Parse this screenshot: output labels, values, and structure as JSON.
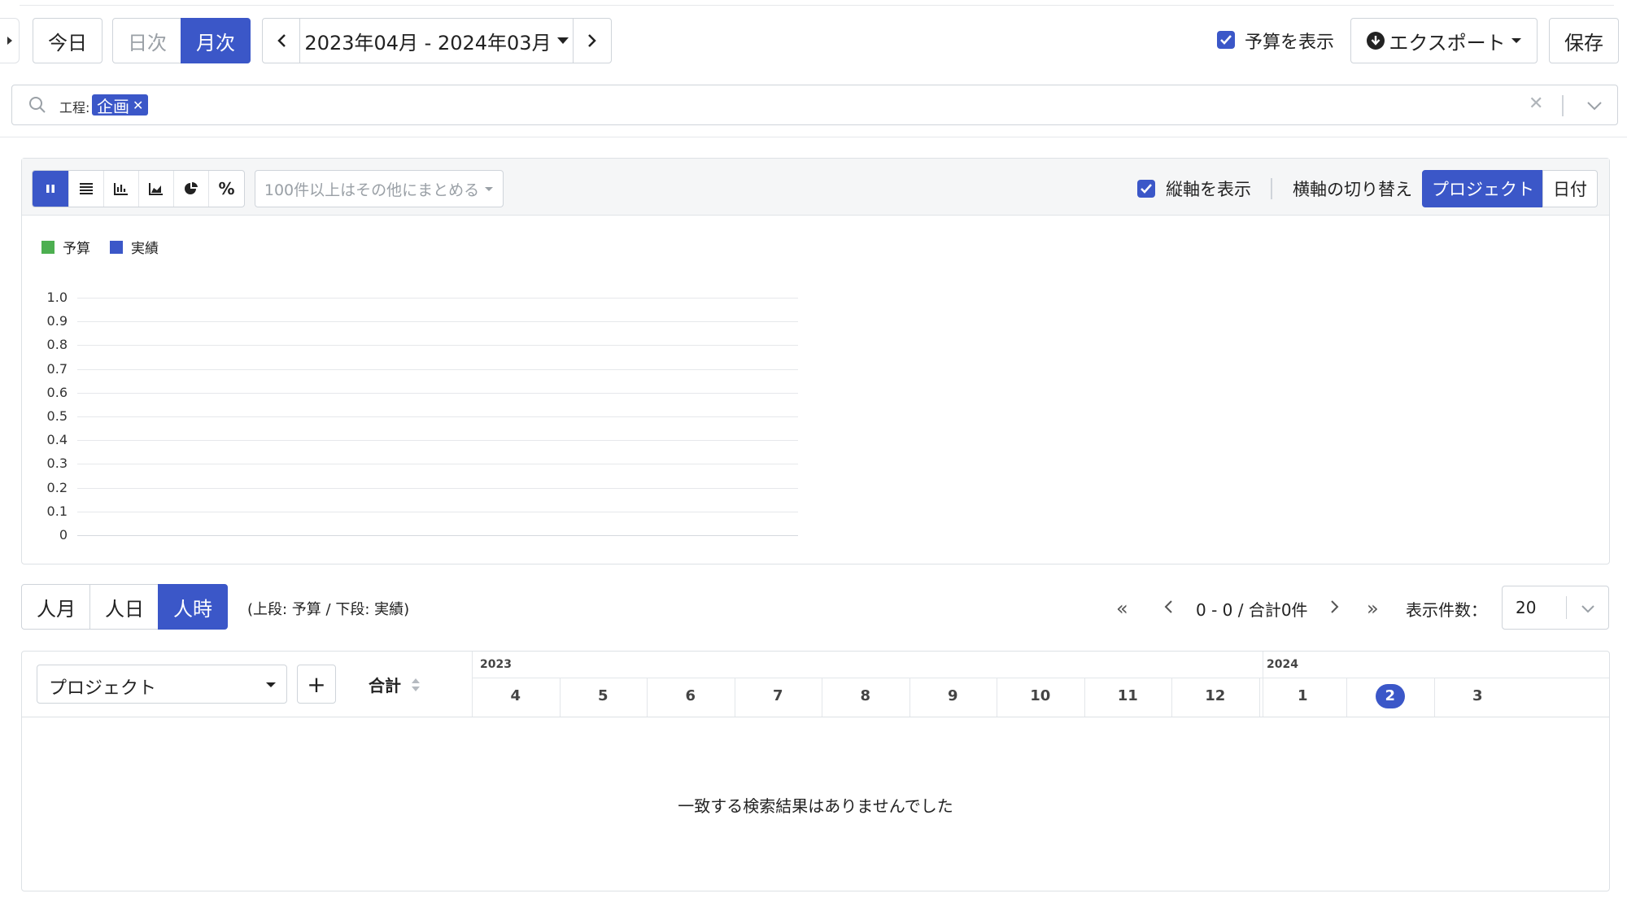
{
  "toolbar": {
    "today": "今日",
    "daily": "日次",
    "monthly": "月次",
    "date_range": "2023年04月 - 2024年03月",
    "show_budget": "予算を表示",
    "export": "エクスポート",
    "save": "保存"
  },
  "filter": {
    "label": "工程:",
    "tag": "企画"
  },
  "chart_toolbar": {
    "group_others": "100件以上はその他にまとめる",
    "show_vertical_axis": "縦軸を表示",
    "switch_horizontal_axis": "横軸の切り替え",
    "axis_project": "プロジェクト",
    "axis_date": "日付"
  },
  "chart_data": {
    "type": "bar",
    "categories": [],
    "series": [
      {
        "name": "予算",
        "color": "#4caf50",
        "values": []
      },
      {
        "name": "実績",
        "color": "#3b57c8",
        "values": []
      }
    ],
    "title": "",
    "xlabel": "",
    "ylabel": "",
    "ylim": [
      0,
      1.0
    ],
    "yticks": [
      "1.0",
      "0.9",
      "0.8",
      "0.7",
      "0.6",
      "0.5",
      "0.4",
      "0.3",
      "0.2",
      "0.1",
      "0"
    ],
    "grid": true,
    "legend": "top-left"
  },
  "units": {
    "man_month": "人月",
    "man_day": "人日",
    "man_hour": "人時",
    "note": "(上段: 予算 / 下段: 実績)"
  },
  "pagination": {
    "summary": "0 - 0 / 合計0件",
    "per_page_label": "表示件数：",
    "per_page_value": "20"
  },
  "table": {
    "group_select": "プロジェクト",
    "add": "+",
    "total": "合計",
    "year1": "2023",
    "year2": "2024",
    "months": [
      "4",
      "5",
      "6",
      "7",
      "8",
      "9",
      "10",
      "11",
      "12",
      "1",
      "2",
      "3"
    ],
    "current_month_index": 10,
    "empty_message": "一致する検索結果はありませんでした"
  },
  "colors": {
    "accent": "#3b57c8",
    "budget": "#4caf50"
  }
}
